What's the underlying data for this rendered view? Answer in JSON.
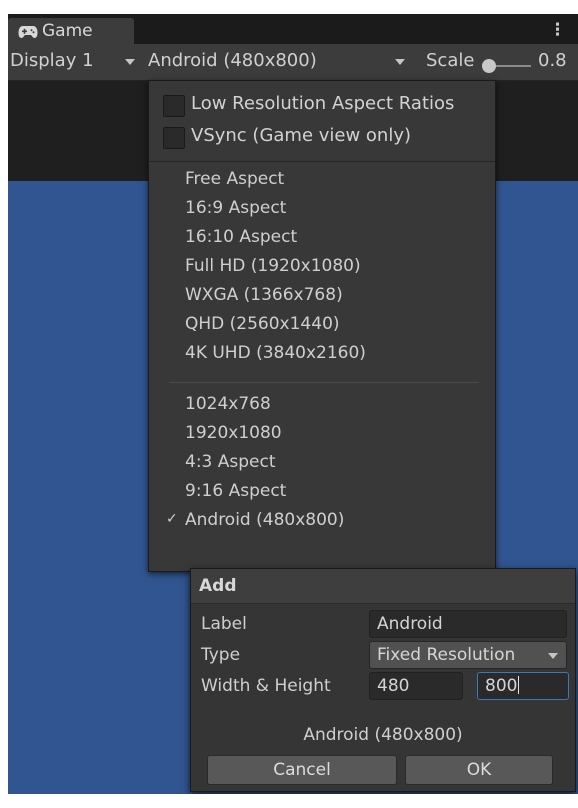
{
  "tab": {
    "icon": "gamepad-icon",
    "label": "Game",
    "menu_icon": "kebab-menu-icon"
  },
  "toolbar": {
    "display": "Display 1",
    "resolution": "Android (480x800)",
    "scale_label": "Scale",
    "scale_value": "0.8"
  },
  "menu": {
    "checkboxes": [
      {
        "label": "Low Resolution Aspect Ratios",
        "checked": false
      },
      {
        "label": "VSync (Game view only)",
        "checked": false
      }
    ],
    "builtin": [
      "Free Aspect",
      "16:9 Aspect",
      "16:10 Aspect",
      "Full HD (1920x1080)",
      "WXGA (1366x768)",
      "QHD (2560x1440)",
      "4K UHD (3840x2160)"
    ],
    "custom": [
      "1024x768",
      "1920x1080",
      "4:3 Aspect",
      "9:16 Aspect",
      "Android (480x800)"
    ],
    "selected": "Android (480x800)",
    "check_glyph": "✓"
  },
  "dialog": {
    "title": "Add",
    "label_caption": "Label",
    "label_value": "Android",
    "type_caption": "Type",
    "type_value": "Fixed Resolution",
    "size_caption": "Width & Height",
    "width_value": "480",
    "height_value": "800",
    "summary": "Android (480x800)",
    "cancel": "Cancel",
    "ok": "OK"
  },
  "colors": {
    "game_background": "#315590",
    "panel": "#383838",
    "focus_border": "#3a79bb"
  }
}
